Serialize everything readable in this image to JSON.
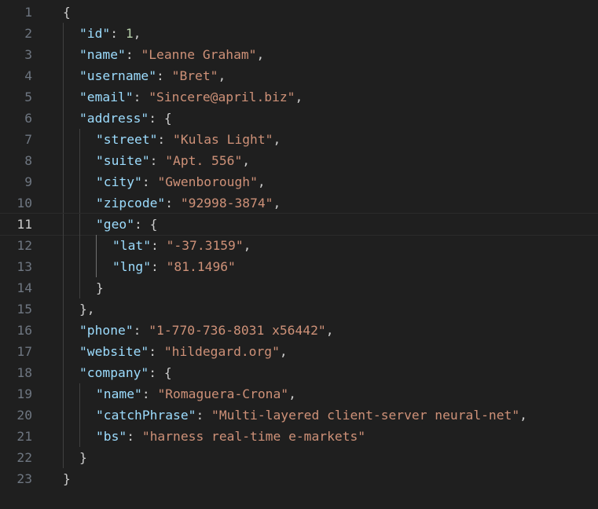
{
  "editor": {
    "current_line": 11,
    "colors": {
      "background": "#1f1f1f",
      "key": "#9cdcfe",
      "string": "#ce9178",
      "number": "#b5cea8",
      "punctuation": "#cccccc",
      "line_number": "#6e7681",
      "current_line_number": "#cccccc"
    },
    "lines": [
      {
        "num": "1",
        "indent": 0,
        "tokens": [
          {
            "t": "punc",
            "v": "{"
          }
        ]
      },
      {
        "num": "2",
        "indent": 1,
        "tokens": [
          {
            "t": "key",
            "v": "\"id\""
          },
          {
            "t": "punc",
            "v": ": "
          },
          {
            "t": "num",
            "v": "1"
          },
          {
            "t": "punc",
            "v": ","
          }
        ]
      },
      {
        "num": "3",
        "indent": 1,
        "tokens": [
          {
            "t": "key",
            "v": "\"name\""
          },
          {
            "t": "punc",
            "v": ": "
          },
          {
            "t": "str",
            "v": "\"Leanne Graham\""
          },
          {
            "t": "punc",
            "v": ","
          }
        ]
      },
      {
        "num": "4",
        "indent": 1,
        "tokens": [
          {
            "t": "key",
            "v": "\"username\""
          },
          {
            "t": "punc",
            "v": ": "
          },
          {
            "t": "str",
            "v": "\"Bret\""
          },
          {
            "t": "punc",
            "v": ","
          }
        ]
      },
      {
        "num": "5",
        "indent": 1,
        "tokens": [
          {
            "t": "key",
            "v": "\"email\""
          },
          {
            "t": "punc",
            "v": ": "
          },
          {
            "t": "str",
            "v": "\"Sincere@april.biz\""
          },
          {
            "t": "punc",
            "v": ","
          }
        ]
      },
      {
        "num": "6",
        "indent": 1,
        "tokens": [
          {
            "t": "key",
            "v": "\"address\""
          },
          {
            "t": "punc",
            "v": ": {"
          }
        ]
      },
      {
        "num": "7",
        "indent": 2,
        "tokens": [
          {
            "t": "key",
            "v": "\"street\""
          },
          {
            "t": "punc",
            "v": ": "
          },
          {
            "t": "str",
            "v": "\"Kulas Light\""
          },
          {
            "t": "punc",
            "v": ","
          }
        ]
      },
      {
        "num": "8",
        "indent": 2,
        "tokens": [
          {
            "t": "key",
            "v": "\"suite\""
          },
          {
            "t": "punc",
            "v": ": "
          },
          {
            "t": "str",
            "v": "\"Apt. 556\""
          },
          {
            "t": "punc",
            "v": ","
          }
        ]
      },
      {
        "num": "9",
        "indent": 2,
        "tokens": [
          {
            "t": "key",
            "v": "\"city\""
          },
          {
            "t": "punc",
            "v": ": "
          },
          {
            "t": "str",
            "v": "\"Gwenborough\""
          },
          {
            "t": "punc",
            "v": ","
          }
        ]
      },
      {
        "num": "10",
        "indent": 2,
        "tokens": [
          {
            "t": "key",
            "v": "\"zipcode\""
          },
          {
            "t": "punc",
            "v": ": "
          },
          {
            "t": "str",
            "v": "\"92998-3874\""
          },
          {
            "t": "punc",
            "v": ","
          }
        ]
      },
      {
        "num": "11",
        "indent": 2,
        "tokens": [
          {
            "t": "key",
            "v": "\"geo\""
          },
          {
            "t": "punc",
            "v": ": {"
          }
        ]
      },
      {
        "num": "12",
        "indent": 3,
        "tokens": [
          {
            "t": "key",
            "v": "\"lat\""
          },
          {
            "t": "punc",
            "v": ": "
          },
          {
            "t": "str",
            "v": "\"-37.3159\""
          },
          {
            "t": "punc",
            "v": ","
          }
        ]
      },
      {
        "num": "13",
        "indent": 3,
        "tokens": [
          {
            "t": "key",
            "v": "\"lng\""
          },
          {
            "t": "punc",
            "v": ": "
          },
          {
            "t": "str",
            "v": "\"81.1496\""
          }
        ]
      },
      {
        "num": "14",
        "indent": 2,
        "tokens": [
          {
            "t": "punc",
            "v": "}"
          }
        ]
      },
      {
        "num": "15",
        "indent": 1,
        "tokens": [
          {
            "t": "punc",
            "v": "},"
          }
        ]
      },
      {
        "num": "16",
        "indent": 1,
        "tokens": [
          {
            "t": "key",
            "v": "\"phone\""
          },
          {
            "t": "punc",
            "v": ": "
          },
          {
            "t": "str",
            "v": "\"1-770-736-8031 x56442\""
          },
          {
            "t": "punc",
            "v": ","
          }
        ]
      },
      {
        "num": "17",
        "indent": 1,
        "tokens": [
          {
            "t": "key",
            "v": "\"website\""
          },
          {
            "t": "punc",
            "v": ": "
          },
          {
            "t": "str",
            "v": "\"hildegard.org\""
          },
          {
            "t": "punc",
            "v": ","
          }
        ]
      },
      {
        "num": "18",
        "indent": 1,
        "tokens": [
          {
            "t": "key",
            "v": "\"company\""
          },
          {
            "t": "punc",
            "v": ": {"
          }
        ]
      },
      {
        "num": "19",
        "indent": 2,
        "tokens": [
          {
            "t": "key",
            "v": "\"name\""
          },
          {
            "t": "punc",
            "v": ": "
          },
          {
            "t": "str",
            "v": "\"Romaguera-Crona\""
          },
          {
            "t": "punc",
            "v": ","
          }
        ]
      },
      {
        "num": "20",
        "indent": 2,
        "tokens": [
          {
            "t": "key",
            "v": "\"catchPhrase\""
          },
          {
            "t": "punc",
            "v": ": "
          },
          {
            "t": "str",
            "v": "\"Multi-layered client-server neural-net\""
          },
          {
            "t": "punc",
            "v": ","
          }
        ]
      },
      {
        "num": "21",
        "indent": 2,
        "tokens": [
          {
            "t": "key",
            "v": "\"bs\""
          },
          {
            "t": "punc",
            "v": ": "
          },
          {
            "t": "str",
            "v": "\"harness real-time e-markets\""
          }
        ]
      },
      {
        "num": "22",
        "indent": 1,
        "tokens": [
          {
            "t": "punc",
            "v": "}"
          }
        ]
      },
      {
        "num": "23",
        "indent": 0,
        "tokens": [
          {
            "t": "punc",
            "v": "}"
          }
        ]
      }
    ]
  }
}
